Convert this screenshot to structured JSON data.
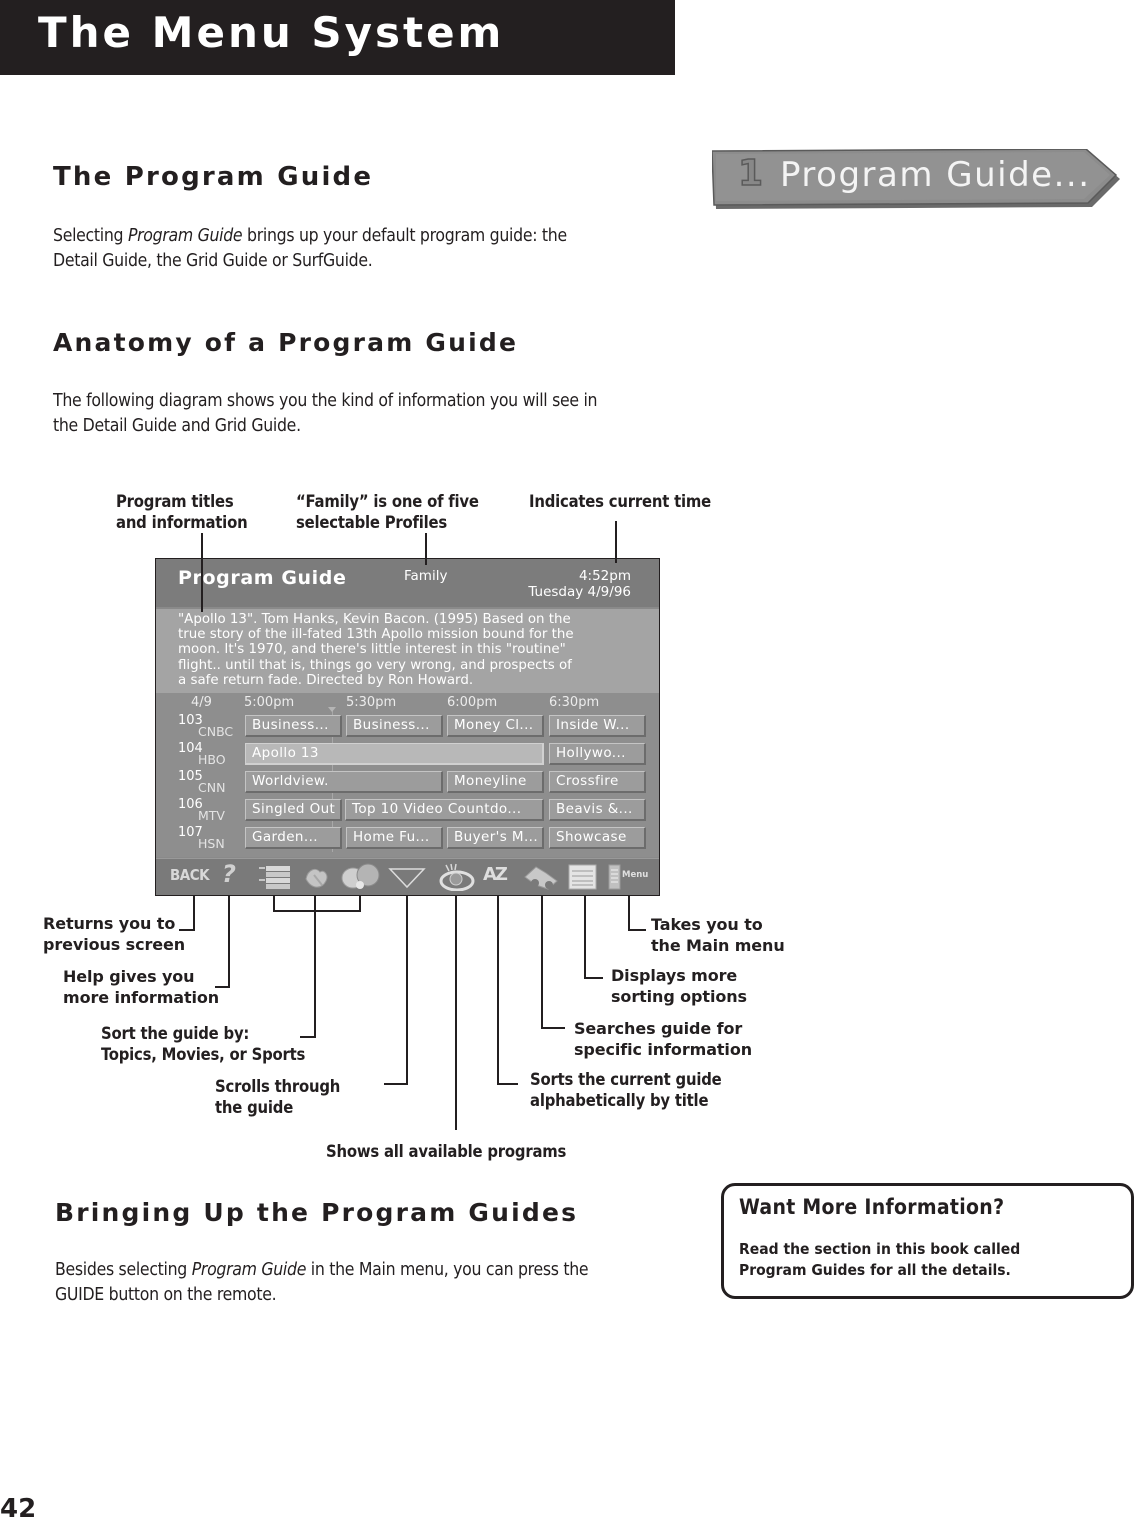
{
  "header": {
    "title": "The Menu System"
  },
  "sections": {
    "program_guide": {
      "heading": "The Program Guide",
      "body_pre": "Selecting ",
      "body_em": "Program Guide",
      "body_post_line1": " brings up your default program guide: the",
      "body_line2": "Detail Guide, the Grid Guide or SurfGuide."
    },
    "anatomy": {
      "heading": "Anatomy of a Program Guide",
      "body_line1": "The following diagram shows you the kind of information you will see in",
      "body_line2": "the Detail Guide and Grid Guide."
    },
    "bringing_up": {
      "heading": "Bringing Up the Program Guides",
      "body_pre": "Besides selecting ",
      "body_em": "Program Guide",
      "body_post_line1": " in the Main menu, you can press the",
      "body_line2": "GUIDE button on the remote."
    }
  },
  "menu_button": {
    "number": "1",
    "label": "Program Guide..."
  },
  "tv_screen": {
    "title": "Program Guide",
    "profile": "Family",
    "time": "4:52pm",
    "date": "Tuesday 4/9/96",
    "description": "\"Apollo 13\". Tom Hanks, Kevin Bacon. (1995) Based on the\ntrue story of the ill-fated 13th Apollo mission bound for the\nmoon. It's 1970, and there's little interest in this \"routine\"\nflight.. until that is, things go very wrong, and prospects of\na safe return fade. Directed by Ron Howard.",
    "grid_date": "4/9",
    "time_slots": [
      "5:00pm",
      "5:30pm",
      "6:00pm",
      "6:30pm"
    ],
    "channels": [
      {
        "number": "103",
        "name": "CNBC",
        "programs": [
          "Business...",
          "Business...",
          "Money Cl...",
          "Inside W..."
        ]
      },
      {
        "number": "104",
        "name": "HBO",
        "programs": [
          "Apollo 13",
          "Hollywo..."
        ]
      },
      {
        "number": "105",
        "name": "CNN",
        "programs": [
          "Worldview.",
          "Moneyline",
          "Crossfire"
        ]
      },
      {
        "number": "106",
        "name": "MTV",
        "programs": [
          "Singled Out",
          "Top 10 Video Countdo...",
          "Beavis &..."
        ]
      },
      {
        "number": "107",
        "name": "HSN",
        "programs": [
          "Garden...",
          "Home Fu...",
          "Buyer's M...",
          "Showcase"
        ]
      }
    ],
    "toolbar": {
      "back_label": "BACK",
      "help_label": "?",
      "az_label": "AZ",
      "menu_label": "Menu",
      "icons": [
        "back",
        "help-icon",
        "topics-icon",
        "movies-icon",
        "sports-icon",
        "scroll-down-icon",
        "all-programs-icon",
        "a-z-sort-icon",
        "search-binoculars-icon",
        "sorting-options-icon",
        "main-menu-icon"
      ]
    }
  },
  "callouts": {
    "program_titles": [
      "Program titles",
      "and information"
    ],
    "family_profile": [
      "“Family” is one of five",
      "selectable Profiles"
    ],
    "current_time": [
      "Indicates current time"
    ],
    "returns": [
      "Returns you to",
      "previous screen"
    ],
    "help": [
      "Help gives you",
      "more information"
    ],
    "sort_guide": [
      "Sort the guide by:",
      "Topics, Movies, or Sports"
    ],
    "scrolls": [
      "Scrolls through",
      "the guide"
    ],
    "shows_all": [
      "Shows all available programs"
    ],
    "main_menu": [
      "Takes you to",
      "the Main menu"
    ],
    "sorting_options": [
      "Displays more",
      "sorting options"
    ],
    "searches": [
      "Searches guide for",
      "specific information"
    ],
    "alpha_sort": [
      "Sorts the current guide",
      "alphabetically by title"
    ]
  },
  "info_box": {
    "title": "Want More Information?",
    "line1": "Read the section in this book called",
    "line2": "Program Guides for all the details."
  },
  "page_number": "42"
}
